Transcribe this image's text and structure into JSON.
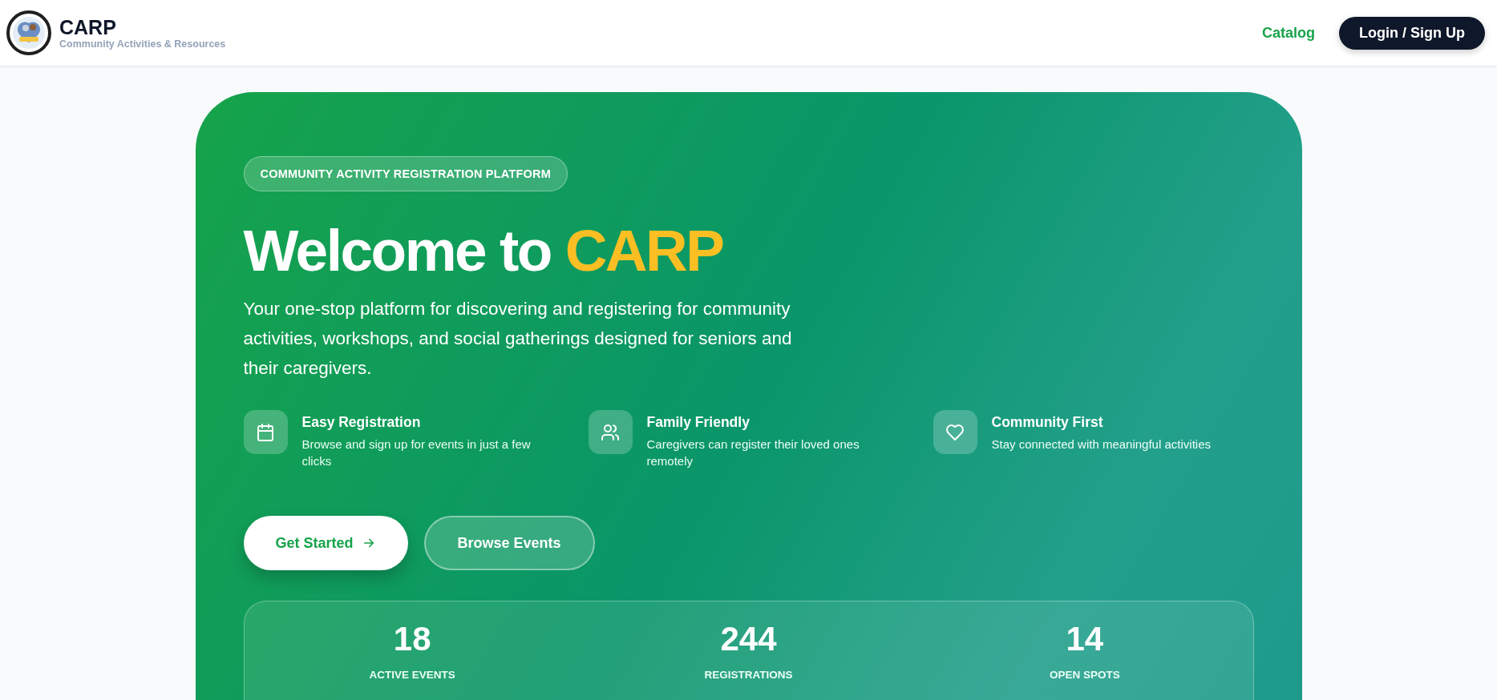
{
  "header": {
    "brand": "CARP",
    "tagline": "Community Activities & Resources",
    "nav": [
      {
        "label": "Catalog",
        "kind": "link"
      },
      {
        "label": "Login / Sign Up",
        "kind": "button"
      }
    ]
  },
  "hero": {
    "badge": "COMMUNITY ACTIVITY REGISTRATION PLATFORM",
    "title": "Welcome to",
    "title_highlight": "CARP",
    "description": "Your one-stop platform for discovering and registering for community activities, workshops, and social gatherings designed for seniors and their caregivers.",
    "features": [
      {
        "kind": "calendar",
        "title": "Easy Registration",
        "text": "Browse and sign up for events in just a few clicks"
      },
      {
        "kind": "people",
        "title": "Family Friendly",
        "text": "Caregivers can register their loved ones remotely"
      },
      {
        "kind": "heart",
        "title": "Community First",
        "text": "Stay connected with meaningful activities"
      }
    ],
    "buttons": [
      {
        "label": "Get Started",
        "kind": "primary"
      },
      {
        "label": "Browse Events",
        "kind": "secondary"
      }
    ],
    "stats": [
      {
        "value": "18",
        "label": "ACTIVE EVENTS"
      },
      {
        "value": "244",
        "label": "REGISTRATIONS"
      },
      {
        "value": "14",
        "label": "OPEN SPOTS"
      }
    ]
  }
}
